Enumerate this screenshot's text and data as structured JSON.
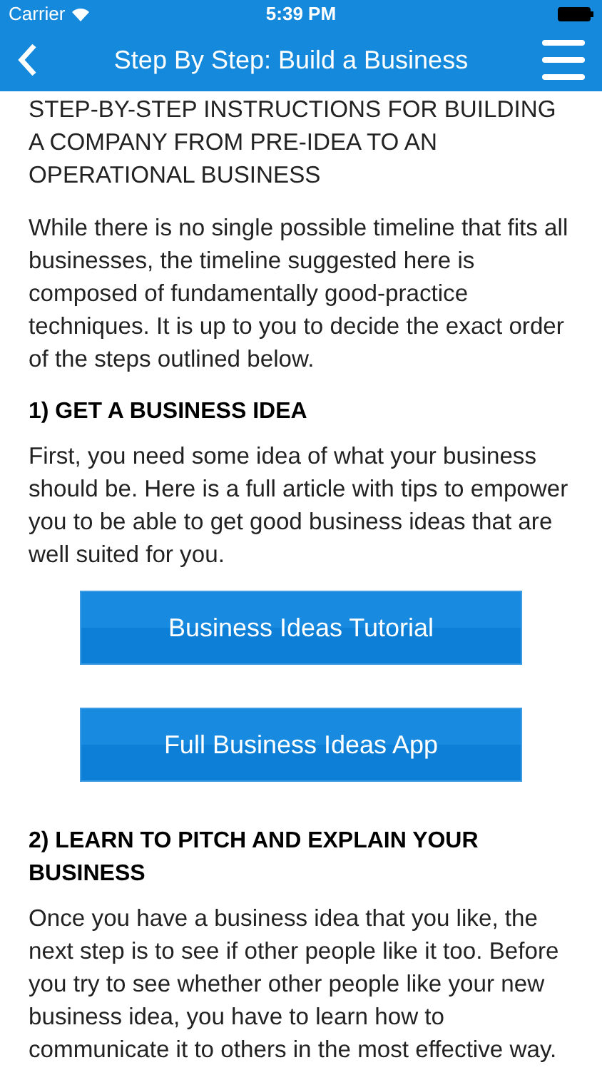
{
  "status_bar": {
    "carrier": "Carrier",
    "time": "5:39 PM"
  },
  "nav_bar": {
    "title": "Step By Step: Build a Business"
  },
  "content": [
    {
      "kind": "text",
      "text": "STEP-BY-STEP INSTRUCTIONS FOR BUILDING A COMPANY FROM PRE-IDEA TO AN OPERATIONAL BUSINESS"
    },
    {
      "kind": "text",
      "text": "While there is no single possible timeline that fits all businesses, the timeline suggested here is composed of fundamentally good-practice techniques. It is up to you to decide the exact order of the steps outlined below."
    },
    {
      "kind": "heading",
      "text": "1) GET A BUSINESS IDEA"
    },
    {
      "kind": "text",
      "text": "First, you need some idea of what your business should be. Here is a full article with tips to empower you to be able to get good business ideas that are well suited for you."
    },
    {
      "kind": "button",
      "text": "Business Ideas Tutorial"
    },
    {
      "kind": "button",
      "text": "Full Business Ideas App"
    },
    {
      "kind": "heading",
      "text": "2) LEARN TO PITCH AND EXPLAIN YOUR BUSINESS"
    },
    {
      "kind": "text",
      "text": "Once you have a business idea that you like, the next step is to see if other people like it too. Before you try to see whether other people like your new business idea, you have to learn how to communicate it to others in the most effective way."
    }
  ]
}
